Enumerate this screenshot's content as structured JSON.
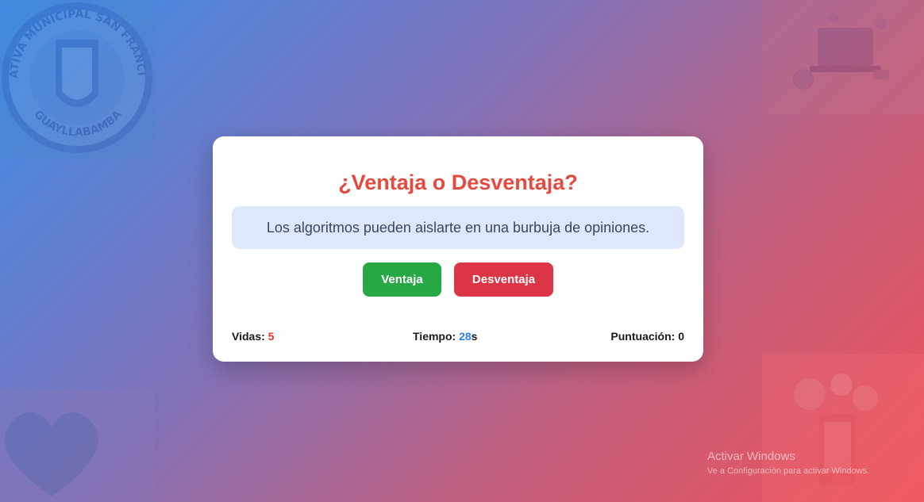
{
  "seal": {
    "top_text": "UNIDAD EDUCATIVA MUNICIPAL SAN FRANCISCO DE QUITO",
    "bottom_text": "GUAYLLABAMBA"
  },
  "corner_images": {
    "top_right": "devices-social-media-illustration",
    "bottom_left": "heart-of-app-icons-illustration",
    "bottom_right": "phone-social-media-illustration"
  },
  "game": {
    "title": "¿Ventaja o Desventaja?",
    "statement": "Los algoritmos pueden aislarte en una burbuja de opiniones.",
    "buttons": {
      "advantage_label": "Ventaja",
      "disadvantage_label": "Desventaja"
    },
    "stats": {
      "lives_label": "Vidas:",
      "lives_value": "5",
      "time_label": "Tiempo:",
      "time_value": "28",
      "time_unit": "s",
      "score_label": "Puntuación:",
      "score_value": "0"
    }
  },
  "watermark": {
    "title": "Activar Windows",
    "subtitle": "Ve a Configuración para activar Windows."
  },
  "colors": {
    "title": "#e64a3f",
    "advantage_button": "#28a745",
    "disadvantage_button": "#dc3545",
    "lives_value": "#e3342f",
    "time_value": "#2f80ed",
    "statement_background": "#dde9fb"
  }
}
